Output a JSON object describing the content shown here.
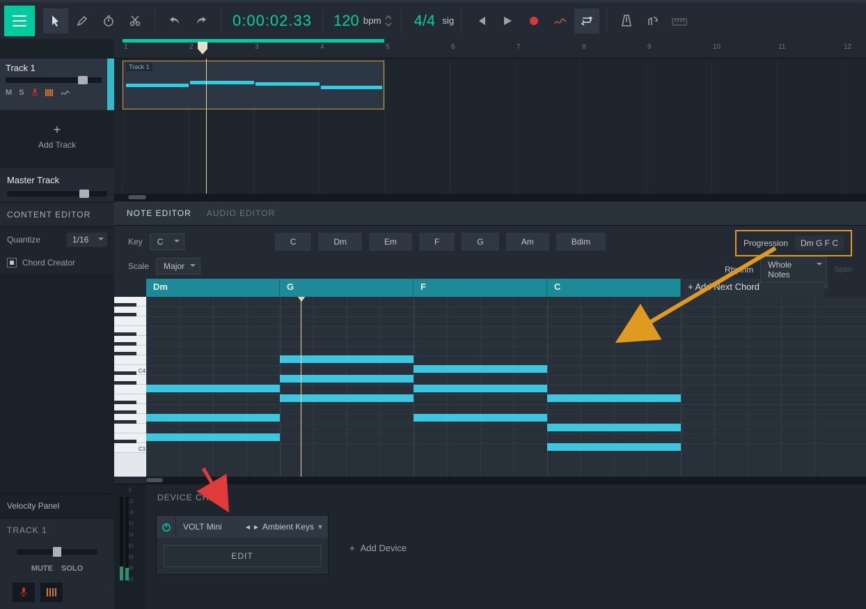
{
  "toolbar": {
    "time": "0:00:02.33",
    "bpm_value": "120",
    "bpm_label": "bpm",
    "sig_value": "4/4",
    "sig_label": "sig"
  },
  "tracklist": {
    "track1_name": "Track 1",
    "mute": "M",
    "solo": "S",
    "add_track": "Add Track",
    "master": "Master Track"
  },
  "content_editor": {
    "title": "CONTENT EDITOR",
    "quantize_label": "Quantize",
    "quantize_value": "1/16",
    "chord_creator": "Chord Creator",
    "velocity_panel": "Velocity Panel"
  },
  "editor_tabs": {
    "note": "NOTE EDITOR",
    "audio": "AUDIO EDITOR"
  },
  "note_editor": {
    "key_label": "Key",
    "key_value": "C",
    "scale_label": "Scale",
    "scale_value": "Major",
    "chords": [
      "C",
      "Dm",
      "Em",
      "F",
      "G",
      "Am",
      "Bdim"
    ],
    "progression_label": "Progression",
    "progression_value": "Dm G F C",
    "rhythm_label": "Rhythm",
    "rhythm_value": "Whole Notes",
    "span_label": "Span",
    "chord_track": [
      "Dm",
      "G",
      "F",
      "C"
    ],
    "add_next_chord": "+ Add Next Chord",
    "octaves": {
      "c4": "C4",
      "c3": "C3"
    },
    "ruler_tick": "6"
  },
  "track_footer": {
    "title": "TRACK 1",
    "mute": "MUTE",
    "solo": "SOLO"
  },
  "device_chain": {
    "title": "DEVICE CHAIN",
    "device_name": "VOLT Mini",
    "preset": "Ambient Keys",
    "edit": "EDIT",
    "add_device": "Add Device",
    "db_ticks": [
      "5",
      "10",
      "14",
      "20",
      "24",
      "30",
      "36",
      "48",
      "60"
    ]
  },
  "arrangement": {
    "clip_label": "Track 1",
    "ruler_numbers": [
      "1",
      "2",
      "3",
      "4",
      "5",
      "6",
      "7",
      "8",
      "9",
      "10",
      "11",
      "12"
    ]
  }
}
